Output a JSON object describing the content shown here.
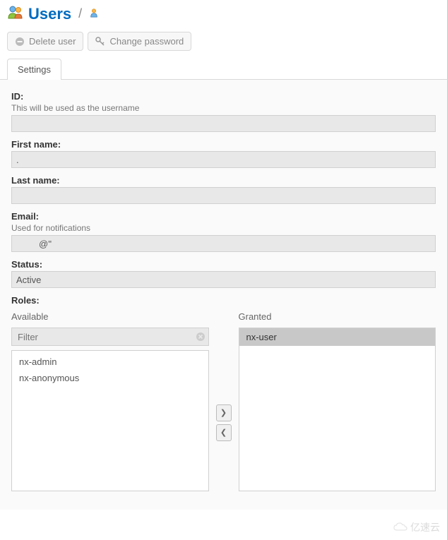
{
  "header": {
    "title": "Users",
    "separator": "/"
  },
  "toolbar": {
    "delete_label": "Delete user",
    "change_password_label": "Change password"
  },
  "tabs": {
    "settings_label": "Settings"
  },
  "form": {
    "id": {
      "label": "ID:",
      "hint": "This will be used as the username",
      "value": ""
    },
    "first_name": {
      "label": "First name:",
      "value": "."
    },
    "last_name": {
      "label": "Last name:",
      "value": ""
    },
    "email": {
      "label": "Email:",
      "hint": "Used for notifications",
      "value": "@''"
    },
    "status": {
      "label": "Status:",
      "value": "Active"
    },
    "roles": {
      "label": "Roles:",
      "available_label": "Available",
      "granted_label": "Granted",
      "filter_placeholder": "Filter",
      "available_items": [
        "nx-admin",
        "nx-anonymous"
      ],
      "granted_items": [
        "nx-user"
      ]
    }
  },
  "watermark": {
    "text": "亿速云"
  }
}
